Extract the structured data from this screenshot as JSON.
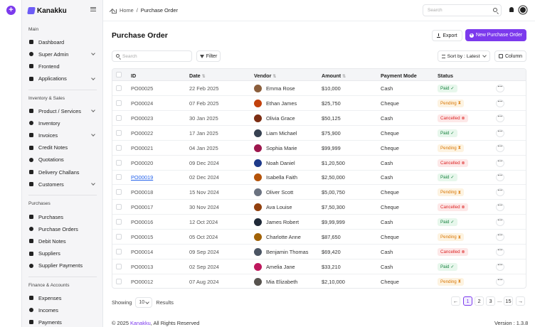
{
  "app": {
    "name": "Kanakku",
    "accent": "#7c3aed"
  },
  "sidebar": {
    "sections": [
      {
        "title": "Main",
        "items": [
          {
            "label": "Dashboard",
            "icon": "dashboard-icon",
            "chevron": false
          },
          {
            "label": "Super Admin",
            "icon": "user-shield-icon",
            "chevron": true
          },
          {
            "label": "Frontend",
            "icon": "globe-icon",
            "chevron": false
          },
          {
            "label": "Applications",
            "icon": "apps-icon",
            "chevron": true
          }
        ]
      },
      {
        "title": "Inventory & Sales",
        "items": [
          {
            "label": "Product / Services",
            "icon": "box-icon",
            "chevron": true
          },
          {
            "label": "Inventory",
            "icon": "inventory-icon",
            "chevron": false
          },
          {
            "label": "Invoices",
            "icon": "invoice-icon",
            "chevron": true
          },
          {
            "label": "Credit Notes",
            "icon": "credit-note-icon",
            "chevron": false
          },
          {
            "label": "Quotations",
            "icon": "quotation-icon",
            "chevron": false
          },
          {
            "label": "Delivery Challans",
            "icon": "truck-icon",
            "chevron": false
          },
          {
            "label": "Customers",
            "icon": "users-icon",
            "chevron": true
          }
        ]
      },
      {
        "title": "Purchases",
        "items": [
          {
            "label": "Purchases",
            "icon": "cart-icon",
            "chevron": false
          },
          {
            "label": "Purchase Orders",
            "icon": "order-icon",
            "chevron": false
          },
          {
            "label": "Debit Notes",
            "icon": "debit-note-icon",
            "chevron": false
          },
          {
            "label": "Suppliers",
            "icon": "supplier-icon",
            "chevron": false
          },
          {
            "label": "Supplier Payments",
            "icon": "payment-icon",
            "chevron": false
          }
        ]
      },
      {
        "title": "Finance & Accounts",
        "items": [
          {
            "label": "Expenses",
            "icon": "expense-icon",
            "chevron": false
          },
          {
            "label": "Incomes",
            "icon": "income-icon",
            "chevron": false
          },
          {
            "label": "Payments",
            "icon": "wallet-icon",
            "chevron": false
          }
        ]
      }
    ]
  },
  "topbar": {
    "breadcrumb_home": "Home",
    "breadcrumb_sep": "/",
    "breadcrumb_current": "Purchase Order",
    "search_placeholder": "Search"
  },
  "page": {
    "title": "Purchase Order",
    "export_label": "Export",
    "new_label": "New Purchase Order"
  },
  "toolbar": {
    "search_placeholder": "Search",
    "filter_label": "Filter",
    "sort_label": "Sort by : Latest",
    "column_label": "Column"
  },
  "table": {
    "headers": {
      "id": "ID",
      "date": "Date",
      "vendor": "Vendor",
      "amount": "Amount",
      "payment_mode": "Payment Mode",
      "status": "Status"
    },
    "rows": [
      {
        "id": "PO00025",
        "date": "22 Feb 2025",
        "vendor": "Emma Rose",
        "amount": "$10,000",
        "mode": "Cash",
        "status": "Paid",
        "link": false
      },
      {
        "id": "PO00024",
        "date": "07 Feb 2025",
        "vendor": "Ethan James",
        "amount": "$25,750",
        "mode": "Cheque",
        "status": "Pending",
        "link": false
      },
      {
        "id": "PO00023",
        "date": "30 Jan 2025",
        "vendor": "Olivia Grace",
        "amount": "$50,125",
        "mode": "Cash",
        "status": "Cancelled",
        "link": false
      },
      {
        "id": "PO00022",
        "date": "17 Jan 2025",
        "vendor": "Liam Michael",
        "amount": "$75,900",
        "mode": "Cheque",
        "status": "Paid",
        "link": false
      },
      {
        "id": "PO00021",
        "date": "04 Jan 2025",
        "vendor": "Sophia Marie",
        "amount": "$99,999",
        "mode": "Cheque",
        "status": "Pending",
        "link": false
      },
      {
        "id": "PO00020",
        "date": "09 Dec 2024",
        "vendor": "Noah Daniel",
        "amount": "$1,20,500",
        "mode": "Cash",
        "status": "Cancelled",
        "link": false
      },
      {
        "id": "PO00019",
        "date": "02 Dec 2024",
        "vendor": "Isabella Faith",
        "amount": "$2,50,000",
        "mode": "Cash",
        "status": "Paid",
        "link": true
      },
      {
        "id": "PO00018",
        "date": "15 Nov 2024",
        "vendor": "Oliver Scott",
        "amount": "$5,00,750",
        "mode": "Cheque",
        "status": "Pending",
        "link": false
      },
      {
        "id": "PO00017",
        "date": "30 Nov 2024",
        "vendor": "Ava Louise",
        "amount": "$7,50,300",
        "mode": "Cheque",
        "status": "Cancelled",
        "link": false
      },
      {
        "id": "PO00016",
        "date": "12 Oct 2024",
        "vendor": "James Robert",
        "amount": "$9,99,999",
        "mode": "Cash",
        "status": "Paid",
        "link": false
      },
      {
        "id": "PO00015",
        "date": "05 Oct 2024",
        "vendor": "Charlotte Anne",
        "amount": "$87,650",
        "mode": "Cheque",
        "status": "Pending",
        "link": false
      },
      {
        "id": "PO00014",
        "date": "09 Sep 2024",
        "vendor": "Benjamin Thomas",
        "amount": "$69,420",
        "mode": "Cash",
        "status": "Cancelled",
        "link": false
      },
      {
        "id": "PO00013",
        "date": "02 Sep 2024",
        "vendor": "Amelia Jane",
        "amount": "$33,210",
        "mode": "Cash",
        "status": "Paid",
        "link": false
      },
      {
        "id": "PO00012",
        "date": "07 Aug 2024",
        "vendor": "Mia Elizabeth",
        "amount": "$2,10,000",
        "mode": "Cheque",
        "status": "Pending",
        "link": false
      }
    ]
  },
  "pagination": {
    "showing_label": "Showing",
    "page_size": "10",
    "results_label": "Results",
    "pages": [
      "1",
      "2",
      "3"
    ],
    "ellipsis": "...",
    "last_page": "15",
    "active_page": "1"
  },
  "footer": {
    "copyright_prefix": "© 2025 ",
    "brand": "Kanakku",
    "copyright_suffix": ", All Rights Reserved",
    "version": "Version : 1.3.8"
  },
  "status_colors": {
    "Paid": "#15803d",
    "Pending": "#d97706",
    "Cancelled": "#dc2626"
  }
}
